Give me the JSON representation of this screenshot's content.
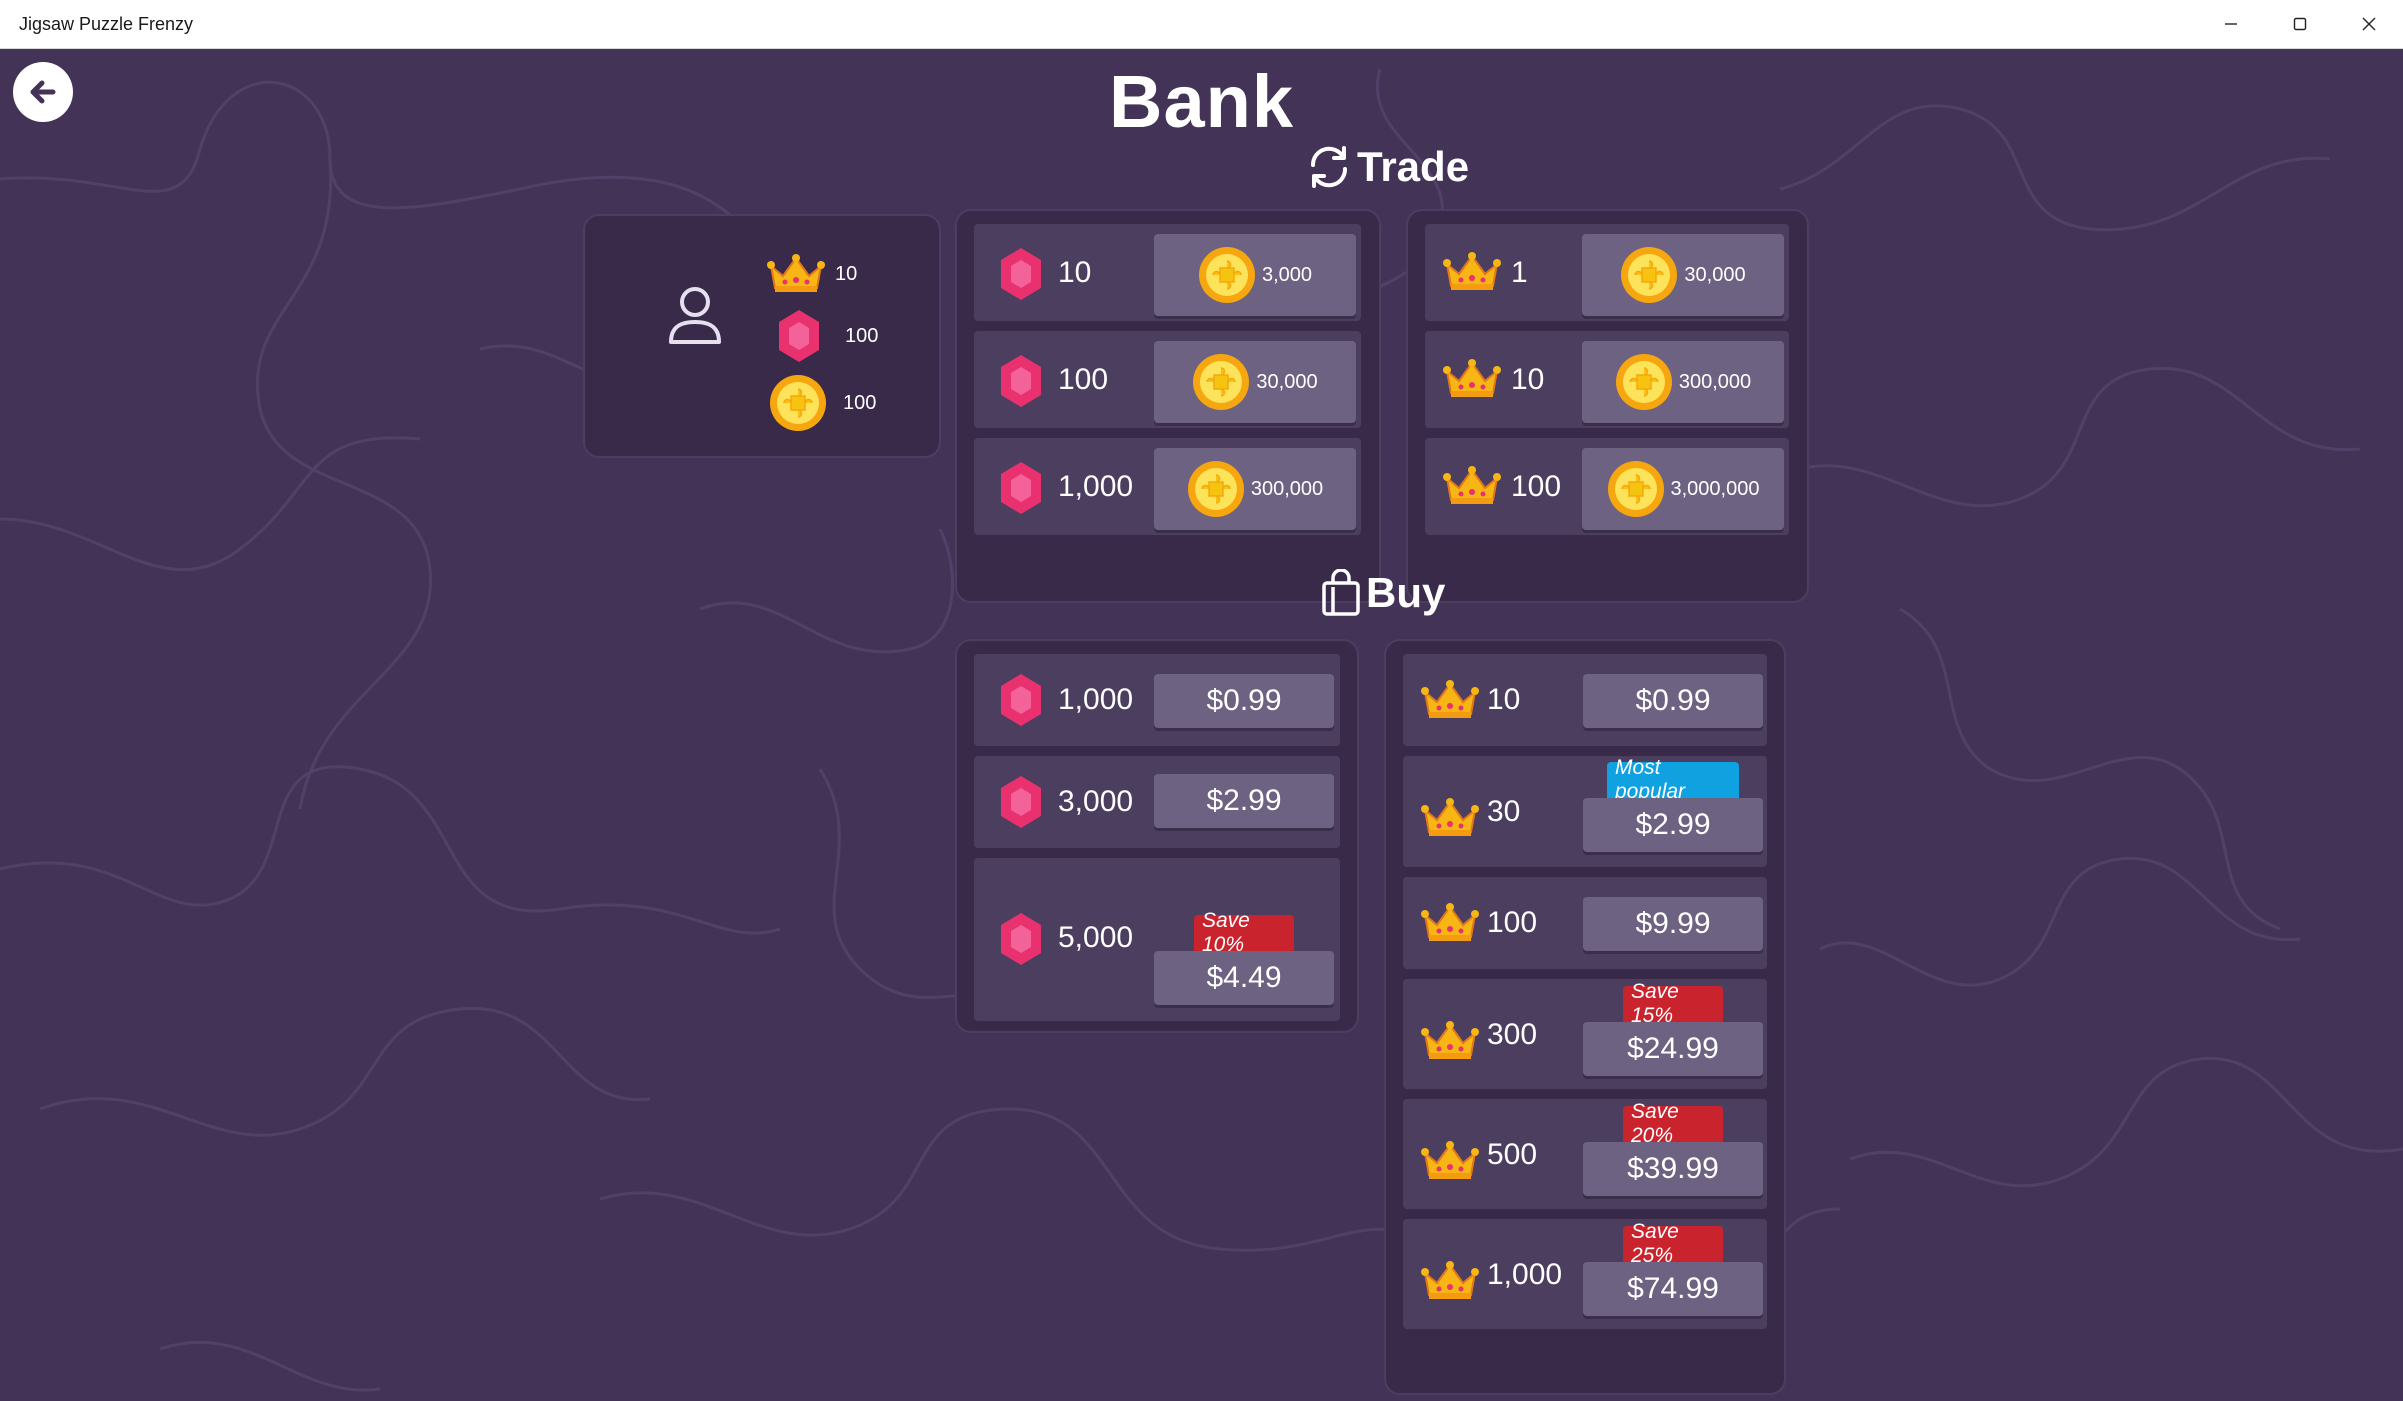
{
  "window": {
    "title": "Jigsaw Puzzle Frenzy"
  },
  "page": {
    "title": "Bank"
  },
  "wallet": {
    "crowns": "10",
    "gems": "100",
    "coins": "100"
  },
  "trade": {
    "title": "Trade",
    "gems": [
      {
        "qty": "10",
        "price": "3,000"
      },
      {
        "qty": "100",
        "price": "30,000"
      },
      {
        "qty": "1,000",
        "price": "300,000"
      }
    ],
    "crowns": [
      {
        "qty": "1",
        "price": "30,000"
      },
      {
        "qty": "10",
        "price": "300,000"
      },
      {
        "qty": "100",
        "price": "3,000,000"
      }
    ]
  },
  "buy": {
    "title": "Buy",
    "gems": [
      {
        "qty": "1,000",
        "price": "$0.99",
        "badge": ""
      },
      {
        "qty": "3,000",
        "price": "$2.99",
        "badge": ""
      },
      {
        "qty": "5,000",
        "price": "$4.49",
        "badge": "Save 10%"
      }
    ],
    "crowns": [
      {
        "qty": "10",
        "price": "$0.99",
        "badge": ""
      },
      {
        "qty": "30",
        "price": "$2.99",
        "badge": "Most popular"
      },
      {
        "qty": "100",
        "price": "$9.99",
        "badge": ""
      },
      {
        "qty": "300",
        "price": "$24.99",
        "badge": "Save 15%"
      },
      {
        "qty": "500",
        "price": "$39.99",
        "badge": "Save 20%"
      },
      {
        "qty": "1,000",
        "price": "$74.99",
        "badge": "Save 25%"
      }
    ]
  },
  "icons": {
    "back": "back-arrow-icon",
    "user": "user-icon",
    "crown": "crown-icon",
    "gem": "gem-icon",
    "coin": "coin-icon",
    "trade": "refresh-icon",
    "buy": "shopping-bag-icon"
  },
  "colors": {
    "background": "#433356",
    "panel": "#392a4a",
    "row": "#4c3e5f",
    "price_button": "#6d6281",
    "save_badge": "#c9232d",
    "popular_badge": "#10a1e0",
    "gem": "#e8316e",
    "coin": "#f6c30f",
    "crown": "#f7b614"
  }
}
